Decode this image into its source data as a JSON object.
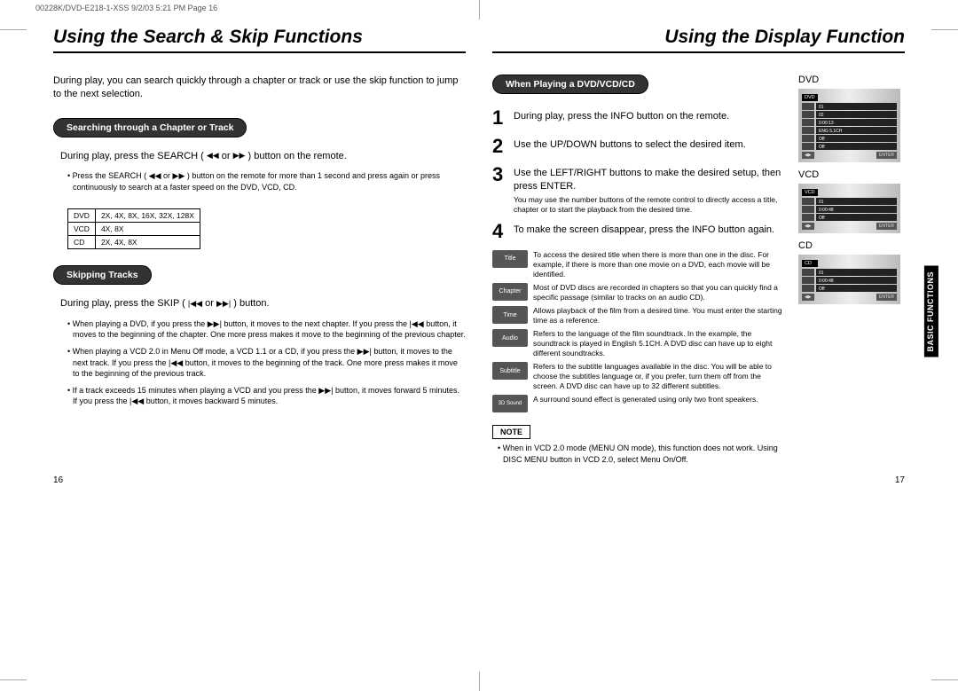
{
  "slug": "00228K/DVD-E218-1-XSS  9/2/03 5:21 PM  Page 16",
  "left": {
    "title": "Using the Search & Skip Functions",
    "intro": "During play, you can search quickly through a chapter or track or use the skip function to jump to the next selection.",
    "section1": {
      "heading": "Searching through a Chapter or Track",
      "body_pre": "During play, press the SEARCH (",
      "body_mid": " or ",
      "body_post": ") button on the remote.",
      "note": "Press the SEARCH ( ◀◀ or ▶▶ ) button on the remote for more than 1 second and press again or press continuously to search at a faster speed on the DVD, VCD, CD.",
      "table": {
        "r1a": "DVD",
        "r1b": "2X, 4X, 8X, 16X, 32X, 128X",
        "r2a": "VCD",
        "r2b": "4X, 8X",
        "r3a": "CD",
        "r3b": "2X, 4X, 8X"
      }
    },
    "section2": {
      "heading": "Skipping Tracks",
      "body_pre": "During play, press the SKIP (",
      "body_mid": " or ",
      "body_post": ") button.",
      "notes": [
        "When playing a DVD, if you press the ▶▶| button, it moves to the next chapter. If you press the |◀◀ button, it moves to the beginning of the chapter. One more press makes it move to the beginning of the previous chapter.",
        "When playing a VCD 2.0 in Menu Off mode, a VCD 1.1 or a CD, if you press the ▶▶| button, it moves to the next track. If you press the |◀◀ button, it moves to the beginning of the track. One more press makes it move to the beginning of the previous track.",
        "If a track exceeds 15 minutes when playing a VCD and you press the ▶▶| button, it moves forward 5 minutes. If you press the |◀◀ button, it moves backward 5 minutes."
      ]
    },
    "pagenum": "16"
  },
  "right": {
    "title": "Using the Display Function",
    "section_heading": "When Playing a DVD/VCD/CD",
    "steps": [
      {
        "n": "1",
        "t": "During play, press the INFO button on the remote."
      },
      {
        "n": "2",
        "t": "Use the UP/DOWN buttons to select the desired item."
      },
      {
        "n": "3",
        "t": "Use the LEFT/RIGHT buttons to make the desired setup, then press ENTER.",
        "sub": "You may use the number buttons of the remote control to directly access a title, chapter or to start the playback from the desired time."
      },
      {
        "n": "4",
        "t": "To make the screen disappear, press the INFO button again."
      }
    ],
    "icons": [
      {
        "lbl": "Title",
        "d": "To access the desired title when there is more than one in the disc. For example, if there is more than one movie on a DVD, each movie will be identified."
      },
      {
        "lbl": "Chapter",
        "d": "Most of DVD discs are recorded in chapters so that you can quickly find a specific passage (similar to tracks on an audio CD)."
      },
      {
        "lbl": "Time",
        "d": "Allows playback of the film from a desired time. You must enter the starting time as a reference."
      },
      {
        "lbl": "Audio",
        "d": "Refers to the language of the film soundtrack. In the example, the soundtrack is played in English 5.1CH. A DVD disc can have up to eight different soundtracks."
      },
      {
        "lbl": "Subtitle",
        "d": "Refers to the subtitle languages available in the disc. You will be able to choose the subtitles language or, if you prefer, turn them off from the screen. A DVD disc can have up to 32 different subtitles."
      },
      {
        "lbl": "3D Sound",
        "d": "A surround sound effect is generated using only two front speakers."
      }
    ],
    "notebox": "NOTE",
    "notetext": "When in VCD 2.0 mode (MENU ON mode), this function does not work. Using DISC MENU button in VCD 2.0, select Menu On/Off.",
    "osd": {
      "dvd": {
        "label": "DVD",
        "head": "DVD",
        "rows": [
          "01",
          "02",
          "0:00:13",
          "ENG 5.1CH",
          "Off",
          "Off"
        ]
      },
      "vcd": {
        "label": "VCD",
        "head": "VCD",
        "rows": [
          "01",
          "0:00:48",
          "Off"
        ]
      },
      "cd": {
        "label": "CD",
        "head": "CD",
        "rows": [
          "01",
          "0:00:48",
          "Off"
        ]
      }
    },
    "sidetab": "BASIC\nFUNCTIONS",
    "pagenum": "17"
  }
}
